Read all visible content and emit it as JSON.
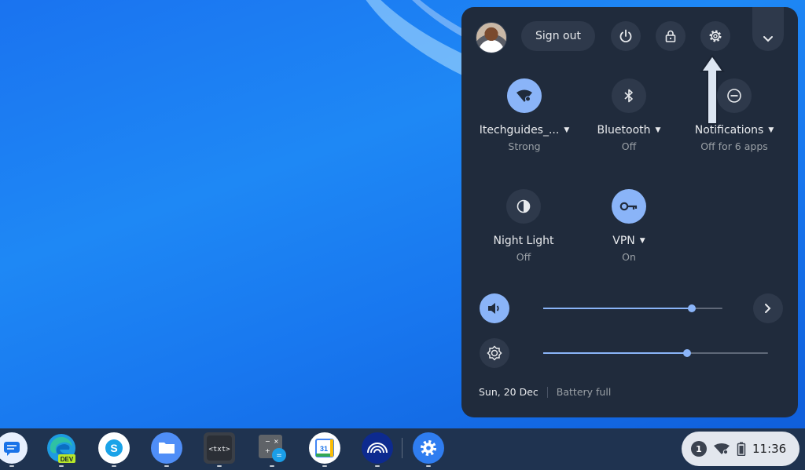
{
  "quick_settings": {
    "sign_out_label": "Sign out",
    "tiles": [
      {
        "label": "Itechguides_...",
        "sub": "Strong",
        "icon": "wifi-icon",
        "state": "on",
        "has_menu": true
      },
      {
        "label": "Bluetooth",
        "sub": "Off",
        "icon": "bluetooth-icon",
        "state": "off",
        "has_menu": true
      },
      {
        "label": "Notifications",
        "sub": "Off for 6 apps",
        "icon": "do-not-disturb-icon",
        "state": "off",
        "has_menu": true
      },
      {
        "label": "Night Light",
        "sub": "Off",
        "icon": "night-light-icon",
        "state": "off",
        "has_menu": false
      },
      {
        "label": "VPN",
        "sub": "On",
        "icon": "vpn-key-icon",
        "state": "on",
        "has_menu": true
      }
    ],
    "volume_level": 0.83,
    "brightness_level": 0.64,
    "date": "Sun, 20 Dec",
    "battery_status": "Battery full"
  },
  "tray": {
    "notification_count": "1",
    "time": "11:36"
  },
  "shelf": {
    "apps": [
      {
        "name": "messages-app-icon",
        "badge": ""
      },
      {
        "name": "edge-dev-app-icon",
        "badge": "DEV"
      },
      {
        "name": "skype-app-icon",
        "badge": ""
      },
      {
        "name": "files-app-icon",
        "badge": ""
      },
      {
        "name": "text-editor-app-icon",
        "badge": "<txt>"
      },
      {
        "name": "calculator-app-icon",
        "badge": ""
      },
      {
        "name": "calendar-app-icon",
        "badge": "31"
      },
      {
        "name": "network-app-icon",
        "badge": ""
      },
      {
        "name": "settings-app-icon",
        "badge": ""
      }
    ]
  },
  "colors": {
    "accent": "#8ab4f8",
    "panel": "#202b3c",
    "desktop": "#1a73f0"
  }
}
